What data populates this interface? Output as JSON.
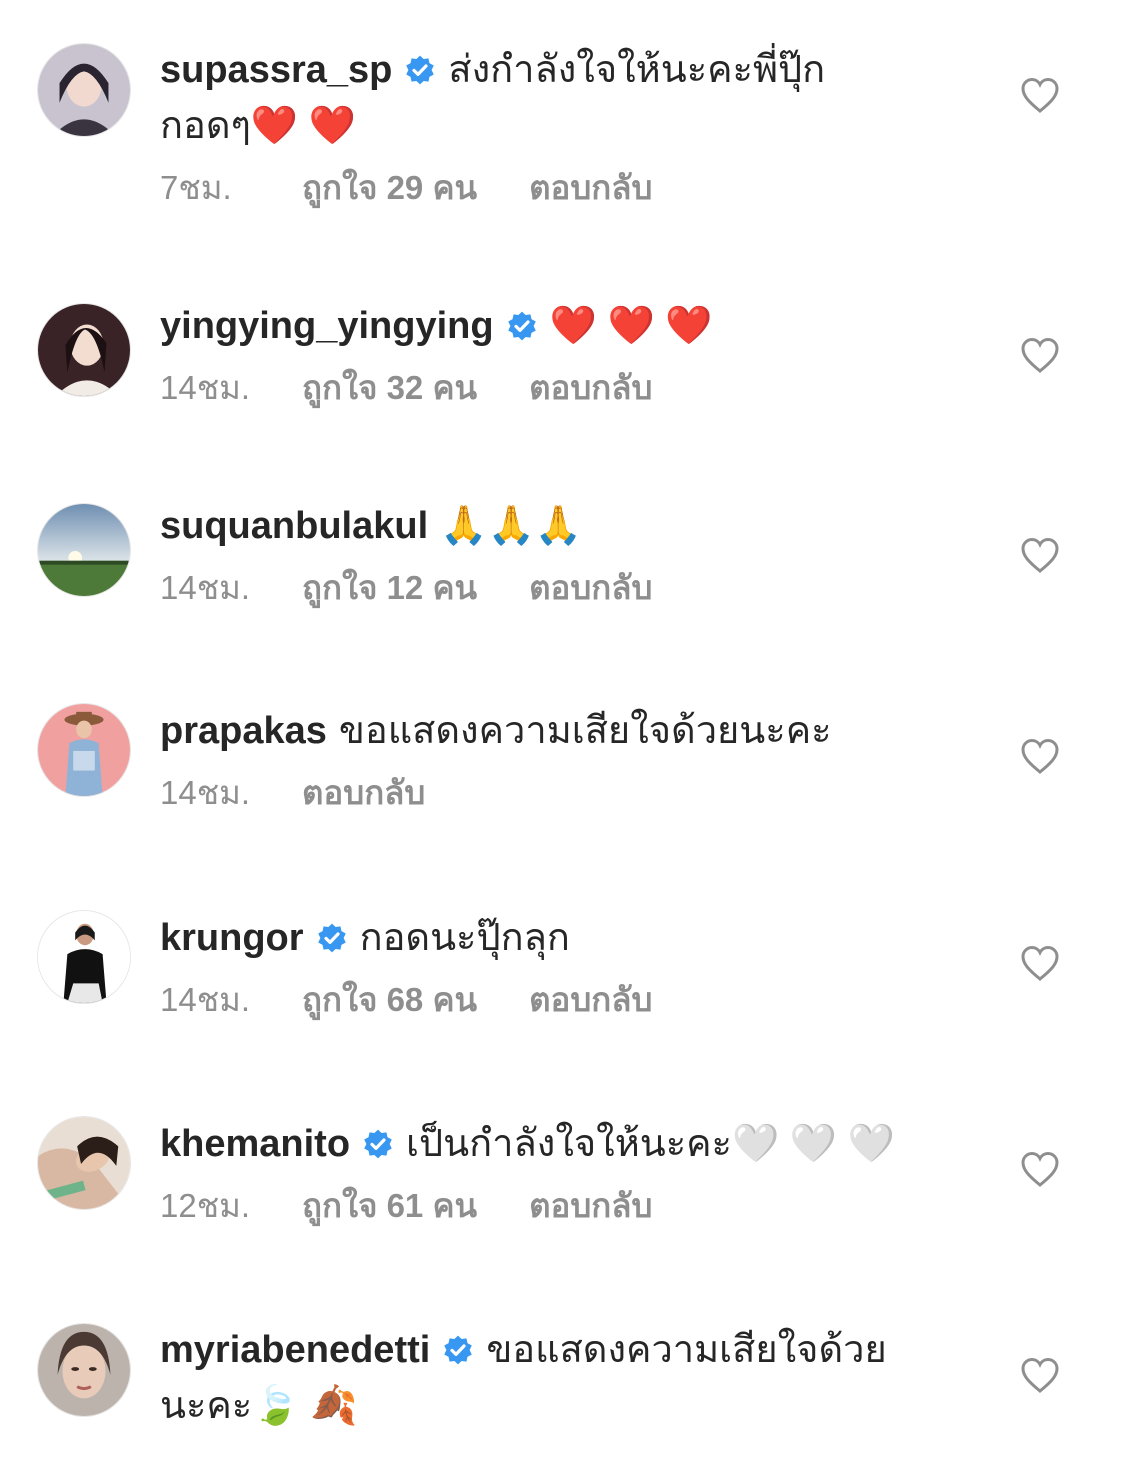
{
  "colors": {
    "username": "#262626",
    "text": "#262626",
    "meta": "#8e8e8e",
    "verified": "#3897f0",
    "heart_outline": "#8e8e8e"
  },
  "icons": {
    "verified": "verified-badge-icon",
    "like": "heart-outline-icon",
    "avatar": "profile-avatar"
  },
  "comments": [
    {
      "username": "supassra_sp",
      "verified": true,
      "text_line1": "ส่งกำลังใจให้นะคะพี่ปุ๊ก",
      "text_line2": "กอดๆ❤️ ❤️",
      "time": "7ชม.",
      "likes": "ถูกใจ 29 คน",
      "reply": "ตอบกลับ"
    },
    {
      "username": "yingying_yingying",
      "verified": true,
      "text_line1": "❤️ ❤️ ❤️",
      "time": "14ชม.",
      "likes": "ถูกใจ 32 คน",
      "reply": "ตอบกลับ"
    },
    {
      "username": "suquanbulakul",
      "verified": false,
      "text_line1": "🙏🙏🙏",
      "time": "14ชม.",
      "likes": "ถูกใจ 12 คน",
      "reply": "ตอบกลับ"
    },
    {
      "username": "prapakas",
      "verified": false,
      "text_line1": "ขอแสดงความเสียใจด้วยนะคะ",
      "time": "14ชม.",
      "likes": "",
      "reply": "ตอบกลับ"
    },
    {
      "username": "krungor",
      "verified": true,
      "text_line1": "กอดนะปุ๊กลุก",
      "time": "14ชม.",
      "likes": "ถูกใจ 68 คน",
      "reply": "ตอบกลับ"
    },
    {
      "username": "khemanito",
      "verified": true,
      "text_line1": "เป็นกำลังใจให้นะคะ🤍 🤍 🤍",
      "time": "12ชม.",
      "likes": "ถูกใจ 61 คน",
      "reply": "ตอบกลับ"
    },
    {
      "username": "myriabenedetti",
      "verified": true,
      "text_line1": "ขอแสดงความเสียใจด้วย",
      "text_line2": "นะคะ🍃 🍂",
      "time": "",
      "likes": "",
      "reply": ""
    }
  ]
}
